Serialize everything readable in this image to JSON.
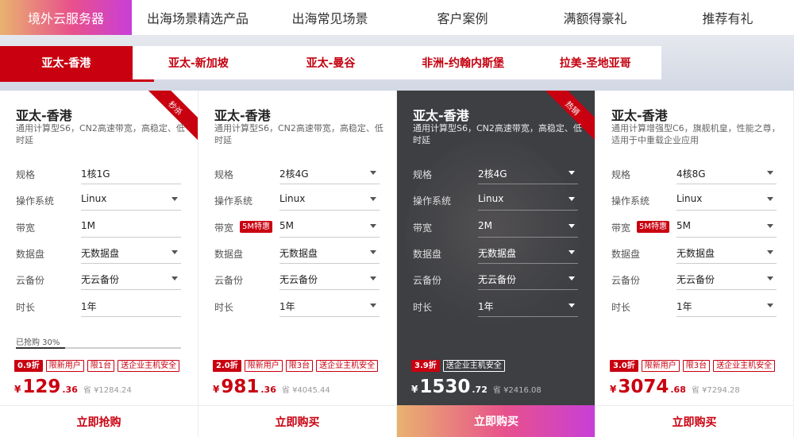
{
  "top_tabs": [
    "境外云服务器",
    "出海场景精选产品",
    "出海常见场景",
    "客户案例",
    "满额得豪礼",
    "推荐有礼"
  ],
  "regions": [
    "亚太-香港",
    "亚太-新加坡",
    "亚太-曼谷",
    "非洲-约翰内斯堡",
    "拉美-圣地亚哥"
  ],
  "labels": {
    "spec": "规格",
    "os": "操作系统",
    "bandwidth": "带宽",
    "disk": "数据盘",
    "backup": "云备份",
    "duration": "时长",
    "orig_prefix": "省",
    "currency": "¥"
  },
  "cards": [
    {
      "title": "亚太-香港",
      "desc": "通用计算型S6，CN2高速带宽，高稳定、低时延",
      "ribbon": "秒杀",
      "spec": "1核1G",
      "os": "Linux",
      "bandwidth": "1M",
      "bandwidth_badge": "",
      "disk": "无数据盘",
      "backup": "无云备份",
      "duration": "1年",
      "progress_label": "已抢购 30%",
      "progress": 0.3,
      "tags": [
        "0.9折",
        "限新用户",
        "限1台",
        "送企业主机安全"
      ],
      "price_int": "129",
      "price_dec": ".36",
      "orig": "¥1284.24",
      "button": "立即抢购"
    },
    {
      "title": "亚太-香港",
      "desc": "通用计算型S6，CN2高速带宽，高稳定、低时延",
      "ribbon": "",
      "spec": "2核4G",
      "os": "Linux",
      "bandwidth": "5M",
      "bandwidth_badge": "5M特惠",
      "disk": "无数据盘",
      "backup": "无云备份",
      "duration": "1年",
      "tags": [
        "2.0折",
        "限新用户",
        "限3台",
        "送企业主机安全"
      ],
      "price_int": "981",
      "price_dec": ".36",
      "orig": "¥4045.44",
      "button": "立即购买"
    },
    {
      "title": "亚太-香港",
      "desc": "通用计算型S6，CN2高速带宽，高稳定、低时延",
      "ribbon": "热销",
      "spec": "2核4G",
      "os": "Linux",
      "bandwidth": "2M",
      "bandwidth_badge": "",
      "disk": "无数据盘",
      "backup": "无云备份",
      "duration": "1年",
      "tags": [
        "3.9折",
        "送企业主机安全"
      ],
      "price_int": "1530",
      "price_dec": ".72",
      "orig": "¥2416.08",
      "button": "立即购买"
    },
    {
      "title": "亚太-香港",
      "desc": "通用计算增强型C6，旗舰机皇，性能之尊，适用于中重载企业应用",
      "ribbon": "",
      "spec": "4核8G",
      "os": "Linux",
      "bandwidth": "5M",
      "bandwidth_badge": "5M特惠",
      "disk": "无数据盘",
      "backup": "无云备份",
      "duration": "1年",
      "tags": [
        "3.0折",
        "限新用户",
        "限3台",
        "送企业主机安全"
      ],
      "price_int": "3074",
      "price_dec": ".68",
      "orig": "¥7294.28",
      "button": "立即购买"
    }
  ]
}
